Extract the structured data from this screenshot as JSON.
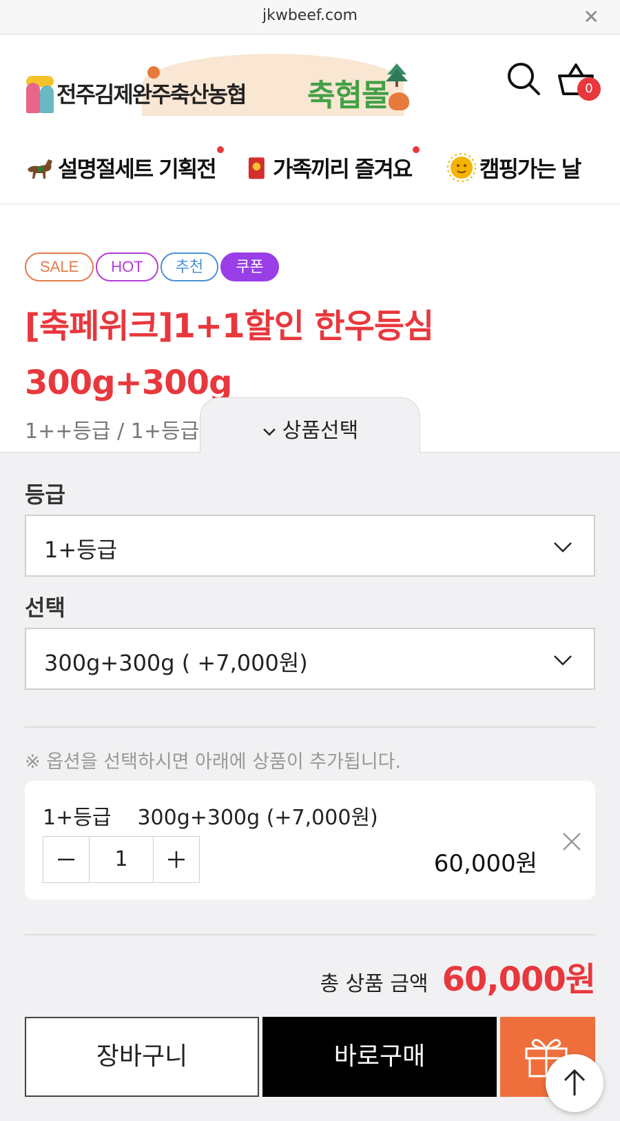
{
  "browser": {
    "url": "jkwbeef.com",
    "close_icon": "close-icon"
  },
  "header": {
    "logo_text": "전주김제완주축산농협",
    "logo_mall": "축협몰",
    "search_icon": "search-icon",
    "cart_icon": "basket-icon",
    "cart_count": "0"
  },
  "nav": {
    "items": [
      {
        "label": "설명절세트 기획전",
        "icon": "horse-icon"
      },
      {
        "label": "가족끼리 즐겨요",
        "icon": "red-envelope-icon"
      },
      {
        "label": "캠핑가는 날",
        "icon": "sun-icon"
      }
    ]
  },
  "product": {
    "badges": [
      "SALE",
      "HOT",
      "추천",
      "쿠폰"
    ],
    "title_line1": "[축페위크]1+1할인 한우등심",
    "title_line2": "300g+300g",
    "subinfo": "1++등급 / 1+등급 / "
  },
  "sheet": {
    "tab_label": "상품선택",
    "grade_label": "등급",
    "grade_value": "1+등급",
    "option_label": "선택",
    "option_value": "300g+300g ( +7,000원)",
    "notice": "※ 옵션을 선택하시면 아래에 상품이 추가됩니다.",
    "item": {
      "grade": "1+등급",
      "option": "300g+300g (+7,000원)",
      "qty": "1",
      "price": "60,000원"
    },
    "total_label": "총 상품 금액",
    "total_amount": "60,000원",
    "cart_button": "장바구니",
    "buy_button": "바로구매"
  },
  "colors": {
    "accent_red": "#e8383d",
    "gift_orange": "#ef6f3c",
    "coupon_purple": "#9a3ee8"
  }
}
